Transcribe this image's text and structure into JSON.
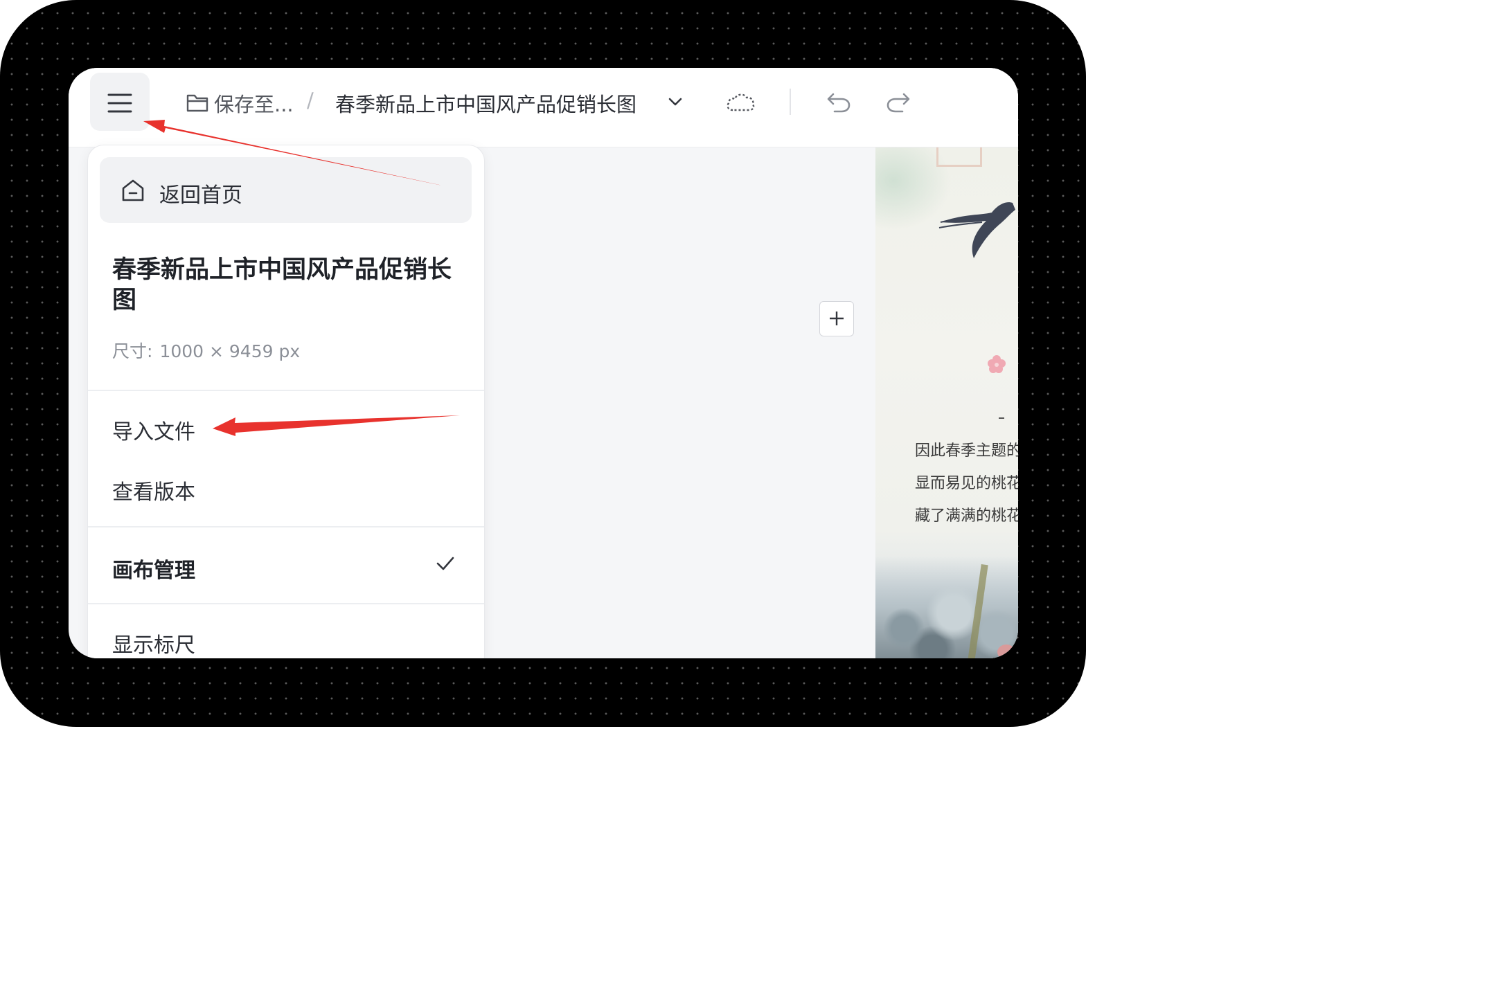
{
  "topbar": {
    "save_label": "保存至...",
    "separator": "/",
    "doc_title": "春季新品上市中国风产品促销长图",
    "icons": [
      "menu-icon",
      "folder-icon",
      "chevron-down-icon",
      "cloud-icon",
      "undo-icon",
      "redo-icon"
    ]
  },
  "dropdown": {
    "home_label": "返回首页",
    "title": "春季新品上市中国风产品促销长图",
    "size_label": "尺寸:",
    "size_value": "1000 × 9459 px",
    "items": {
      "import": "导入文件",
      "versions": "查看版本",
      "canvas_manage": "画布管理",
      "show_ruler": "显示标尺"
    }
  },
  "canvas": {
    "preview_lines": [
      "因此春季主题的",
      "显而易见的桃花",
      "藏了满满的桃花"
    ]
  },
  "colors": {
    "annotation_arrow": "#e8322d",
    "accent_text": "#2b2e35",
    "muted_text": "#8b8f97",
    "frame_bg": "#000000"
  }
}
